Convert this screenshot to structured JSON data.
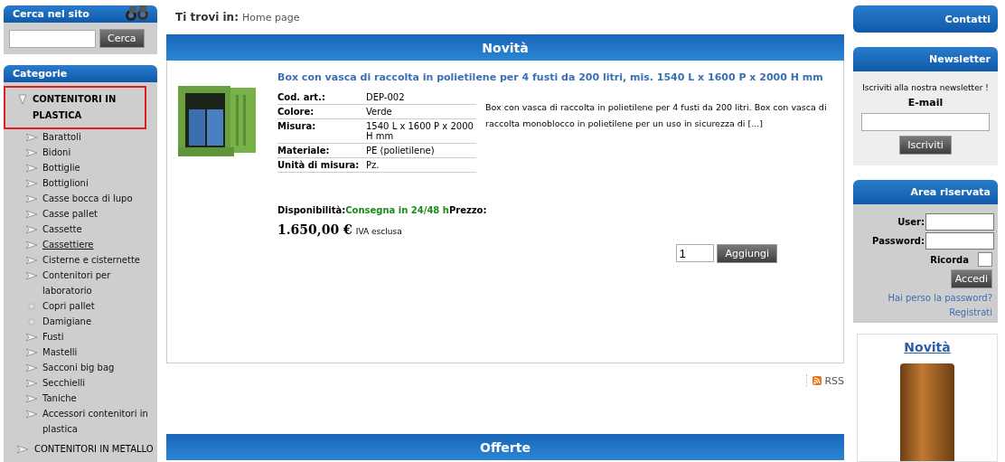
{
  "search": {
    "title": "Cerca nel sito",
    "button": "Cerca"
  },
  "categories": {
    "title": "Categorie",
    "items": [
      {
        "label": "CONTENITORI IN PLASTICA",
        "selected": true,
        "expanded": true,
        "children": [
          {
            "label": "Barattoli",
            "kind": "arrow",
            "hovered": false
          },
          {
            "label": "Bidoni",
            "kind": "arrow",
            "hovered": false
          },
          {
            "label": "Bottiglie",
            "kind": "arrow",
            "hovered": false
          },
          {
            "label": "Bottiglioni",
            "kind": "arrow",
            "hovered": false
          },
          {
            "label": "Casse bocca di lupo",
            "kind": "arrow",
            "hovered": false
          },
          {
            "label": "Casse pallet",
            "kind": "arrow",
            "hovered": false
          },
          {
            "label": "Cassette",
            "kind": "arrow",
            "hovered": false
          },
          {
            "label": "Cassettiere",
            "kind": "arrow",
            "hovered": true
          },
          {
            "label": "Cisterne e cisternette",
            "kind": "arrow",
            "hovered": false
          },
          {
            "label": "Contenitori per laboratorio",
            "kind": "arrow",
            "hovered": false
          },
          {
            "label": "Copri pallet",
            "kind": "dot",
            "hovered": false
          },
          {
            "label": "Damigiane",
            "kind": "dot",
            "hovered": false
          },
          {
            "label": "Fusti",
            "kind": "arrow",
            "hovered": false
          },
          {
            "label": "Mastelli",
            "kind": "arrow",
            "hovered": false
          },
          {
            "label": "Sacconi big bag",
            "kind": "arrow",
            "hovered": false
          },
          {
            "label": "Secchielli",
            "kind": "arrow",
            "hovered": false
          },
          {
            "label": "Taniche",
            "kind": "arrow",
            "hovered": false
          },
          {
            "label": "Accessori contenitori in plastica",
            "kind": "arrow",
            "hovered": false
          }
        ]
      },
      {
        "label": "CONTENITORI IN METALLO",
        "selected": false,
        "expanded": false
      }
    ]
  },
  "breadcrumb": {
    "label": "Ti trovi in:",
    "path": "Home page"
  },
  "news": {
    "title": "Novità",
    "product": {
      "title": "Box con vasca di raccolta in polietilene per 4 fusti da 200 litri, mis. 1540 L x 1600 P x 2000 H mm",
      "specs": [
        {
          "label": "Cod. art.:",
          "value": "DEP-002"
        },
        {
          "label": "Colore:",
          "value": "Verde"
        },
        {
          "label": "Misura:",
          "value": "1540 L x 1600 P x 2000 H mm"
        },
        {
          "label": "Materiale:",
          "value": "PE (polietilene)"
        },
        {
          "label": "Unità di misura:",
          "value": "Pz."
        }
      ],
      "description": "Box con vasca di raccolta in polietilene per 4 fusti da 200 litri. Box con vasca di raccolta monoblocco in polietilene per un uso in sicurezza di [...]",
      "availability_label": "Disponibilità:",
      "availability": "Consegna in 24/48 h",
      "price_label": "Prezzo:",
      "price": "1.650,00 €",
      "tax_note": "IVA esclusa",
      "quantity": "1",
      "add_button": "Aggiungi"
    }
  },
  "rss": "RSS",
  "offers": {
    "title": "Offerte"
  },
  "contacts": {
    "title": "Contatti"
  },
  "newsletter": {
    "title": "Newsletter",
    "intro": "Iscriviti alla nostra newsletter !",
    "email_label": "E-mail",
    "button": "Iscriviti"
  },
  "login": {
    "title": "Area riservata",
    "user_label": "User:",
    "password_label": "Password:",
    "remember_label": "Ricorda",
    "remember": false,
    "button": "Accedi",
    "lost_password": "Hai perso la password?",
    "register": "Registrati"
  },
  "news_box": {
    "title": "Novità"
  }
}
